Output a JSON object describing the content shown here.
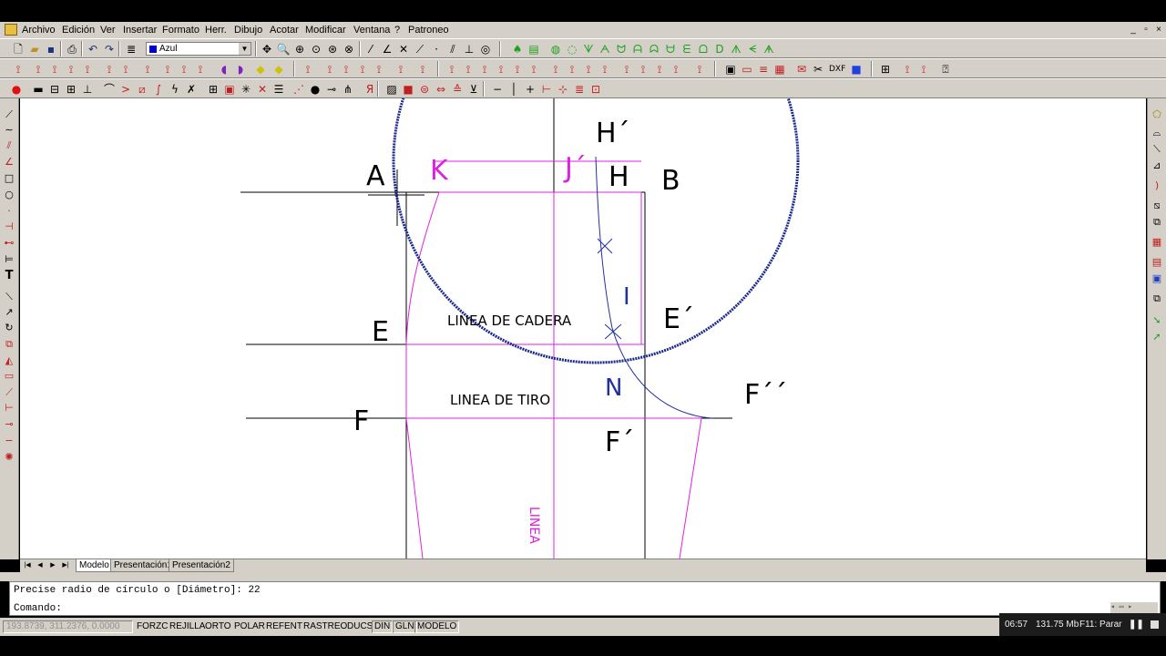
{
  "menu": {
    "items": [
      "Archivo",
      "Edición",
      "Ver",
      "Insertar",
      "Formato",
      "Herr.",
      "Dibujo",
      "Acotar",
      "Modificar",
      "Ventana",
      "?",
      "Patroneo"
    ]
  },
  "window_controls": {
    "minimize": "_",
    "restore": "▫",
    "close": "×"
  },
  "toolbar": {
    "color_value": "Azul",
    "color_swatch": "#0000c0"
  },
  "drawing": {
    "labels": {
      "A": "A",
      "K": "K",
      "J_prime": "J´",
      "H": "H",
      "H_prime": "H´",
      "B": "B",
      "I": "I",
      "E": "E",
      "E_prime": "E´",
      "linea_de_cadera": "LINEA DE CADERA",
      "N": "N",
      "F_dprime": "F´´",
      "linea_de_tiro": "LINEA DE TIRO",
      "F": "F",
      "F_prime": "F´",
      "linea_vertical": "LINEA"
    },
    "colors": {
      "black": "#000000",
      "magenta": "#e020e0",
      "blue": "#2030a0"
    }
  },
  "layout_tabs": {
    "model": "Modelo",
    "layout1": "Presentación1",
    "layout2": "Presentación2"
  },
  "command": {
    "history": "Precise radio de círculo o [Diámetro]: 22",
    "prompt": "Comando:"
  },
  "status": {
    "coordinates": "193.8739, 311.2376, 0.0000",
    "toggles": [
      "FORZC",
      "REJILLA",
      "ORTO",
      "POLAR",
      "REFENT",
      "RASTREO",
      "DUCS",
      "DIN",
      "GLN",
      "MODELO"
    ]
  },
  "recorder": {
    "time": "06:57",
    "memory": "131.75 Mb",
    "hotkey": "F11: Parar"
  }
}
